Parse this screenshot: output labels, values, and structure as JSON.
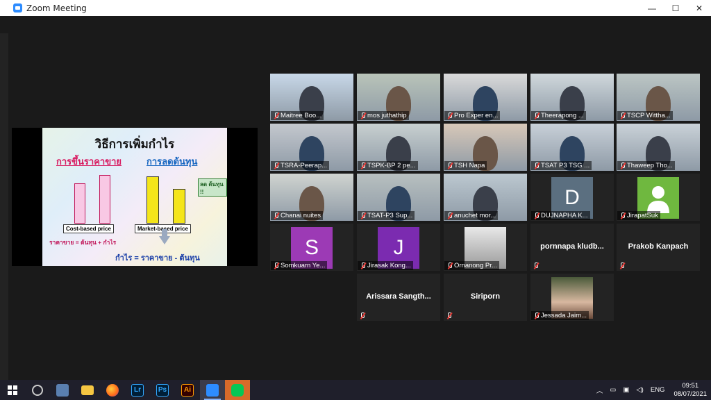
{
  "window": {
    "title": "Zoom Meeting",
    "minimize": "—",
    "maximize": "☐",
    "close": "✕"
  },
  "slide": {
    "title": "วิธีการเพิ่มกำไร",
    "left_heading": "การขึ้นราคาขาย",
    "right_heading": "การลดต้นทุน",
    "left_box": "Cost-based price",
    "right_box": "Market-based price",
    "formula1": "ราคาขาย = ต้นทุน + กำไร",
    "formula2": "กำไร = ราคาขาย - ต้นทุน",
    "reduce_label": "ลด ต้นทุน !!"
  },
  "participants": [
    {
      "name": "Maitree Boo...",
      "type": "video",
      "active": true
    },
    {
      "name": "mos juthathip",
      "type": "video"
    },
    {
      "name": "Pro Exper en...",
      "type": "video"
    },
    {
      "name": "Theerapong ...",
      "type": "video"
    },
    {
      "name": "TSCP Wittha...",
      "type": "video"
    },
    {
      "name": "TSRA-Peerap...",
      "type": "video"
    },
    {
      "name": "TSPK-BP 2 pe...",
      "type": "video"
    },
    {
      "name": "TSH Napa",
      "type": "video"
    },
    {
      "name": "TSAT P3 TSG ...",
      "type": "video"
    },
    {
      "name": "Thaweep Tho...",
      "type": "video"
    },
    {
      "name": "Chanai nuites",
      "type": "video"
    },
    {
      "name": "TSAT-P3 Sup...",
      "type": "video"
    },
    {
      "name": "anuchet mor...",
      "type": "video"
    },
    {
      "name": "DUJNAPHA K...",
      "type": "avatar",
      "letter": "D",
      "color": "#5b6f80"
    },
    {
      "name": "JirapatSuk",
      "type": "avatar",
      "letter": "",
      "color": "#6fb83f"
    },
    {
      "name": "Somkuarn Ye...",
      "type": "avatar",
      "letter": "S",
      "color": "#9c3ab5"
    },
    {
      "name": "Jirasak Kong...",
      "type": "avatar",
      "letter": "J",
      "color": "#7b2bb0"
    },
    {
      "name": "Ornanong Pr...",
      "type": "photo"
    },
    {
      "name": "pornnapa  kludb...",
      "type": "name"
    },
    {
      "name": "Prakob Kanpach",
      "type": "name"
    },
    {
      "name": "Arissara  Sangth...",
      "type": "name"
    },
    {
      "name": "Siriporn",
      "type": "name"
    },
    {
      "name": "Jessada Jaim...",
      "type": "photo"
    }
  ],
  "taskbar": {
    "apps": [
      "windows-start",
      "obs",
      "bluetooth-app",
      "file-explorer",
      "firefox",
      "lightroom",
      "photoshop",
      "illustrator",
      "zoom",
      "line"
    ],
    "app_labels": {
      "lr": "Lr",
      "ps": "Ps",
      "ai": "Ai"
    },
    "lang": "ENG",
    "time": "09:51",
    "date": "08/07/2021"
  }
}
